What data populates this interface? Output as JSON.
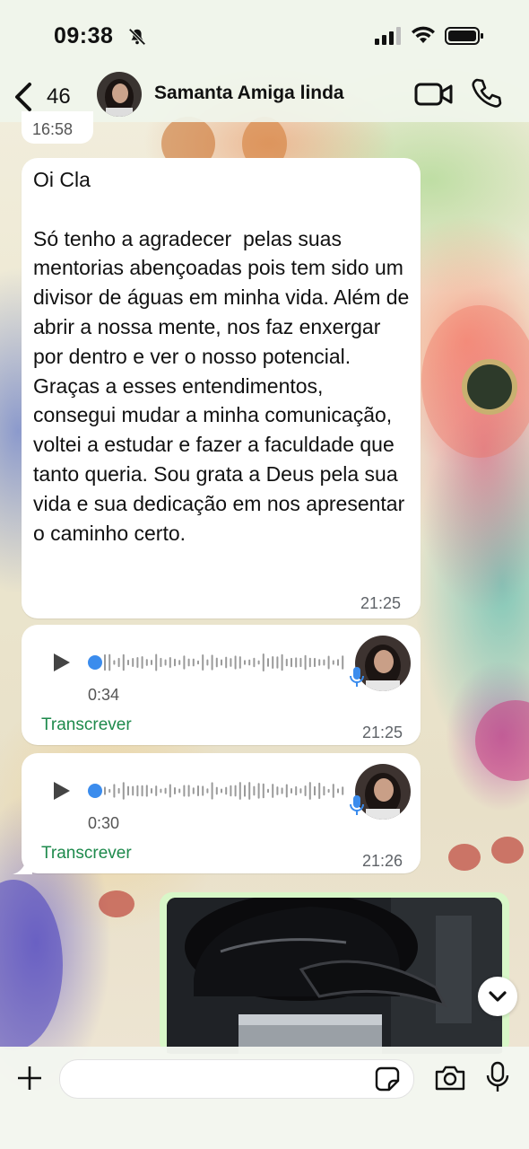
{
  "status_bar": {
    "time": "09:38"
  },
  "header": {
    "back_count": "46",
    "contact_name": "Samanta Amiga linda"
  },
  "colors": {
    "accent_green": "#1e8a4c",
    "voice_dot_blue": "#3b8ced",
    "bubble_bg": "#ffffff"
  },
  "messages": [
    {
      "type": "partial",
      "time": "16:58"
    },
    {
      "type": "text",
      "text": "Oi Cla\n\nSó tenho a agradecer  pelas suas mentorias abençoadas pois tem sido um divisor de águas em minha vida. Além de abrir a nossa mente, nos faz enxergar por dentro e ver o nosso potencial. Graças a esses entendimentos, consegui mudar a minha comunicação, voltei a estudar e fazer a faculdade que tanto queria. Sou grata a Deus pela sua vida e sua dedicação em nos apresentar o caminho certo.",
      "time": "21:25"
    },
    {
      "type": "voice",
      "duration": "0:34",
      "transcribe": "Transcrever",
      "time": "21:25",
      "progress": 0
    },
    {
      "type": "voice",
      "duration": "0:30",
      "transcribe": "Transcrever",
      "time": "21:26",
      "progress": 0
    },
    {
      "type": "image"
    }
  ],
  "input": {
    "placeholder": ""
  },
  "icons": [
    "back-chevron-icon",
    "video-call-icon",
    "phone-icon",
    "play-icon",
    "microphone-icon",
    "plus-icon",
    "sticker-icon",
    "camera-icon",
    "chevron-down-icon",
    "bell-slash-icon",
    "signal-icon",
    "wifi-icon",
    "battery-icon"
  ]
}
